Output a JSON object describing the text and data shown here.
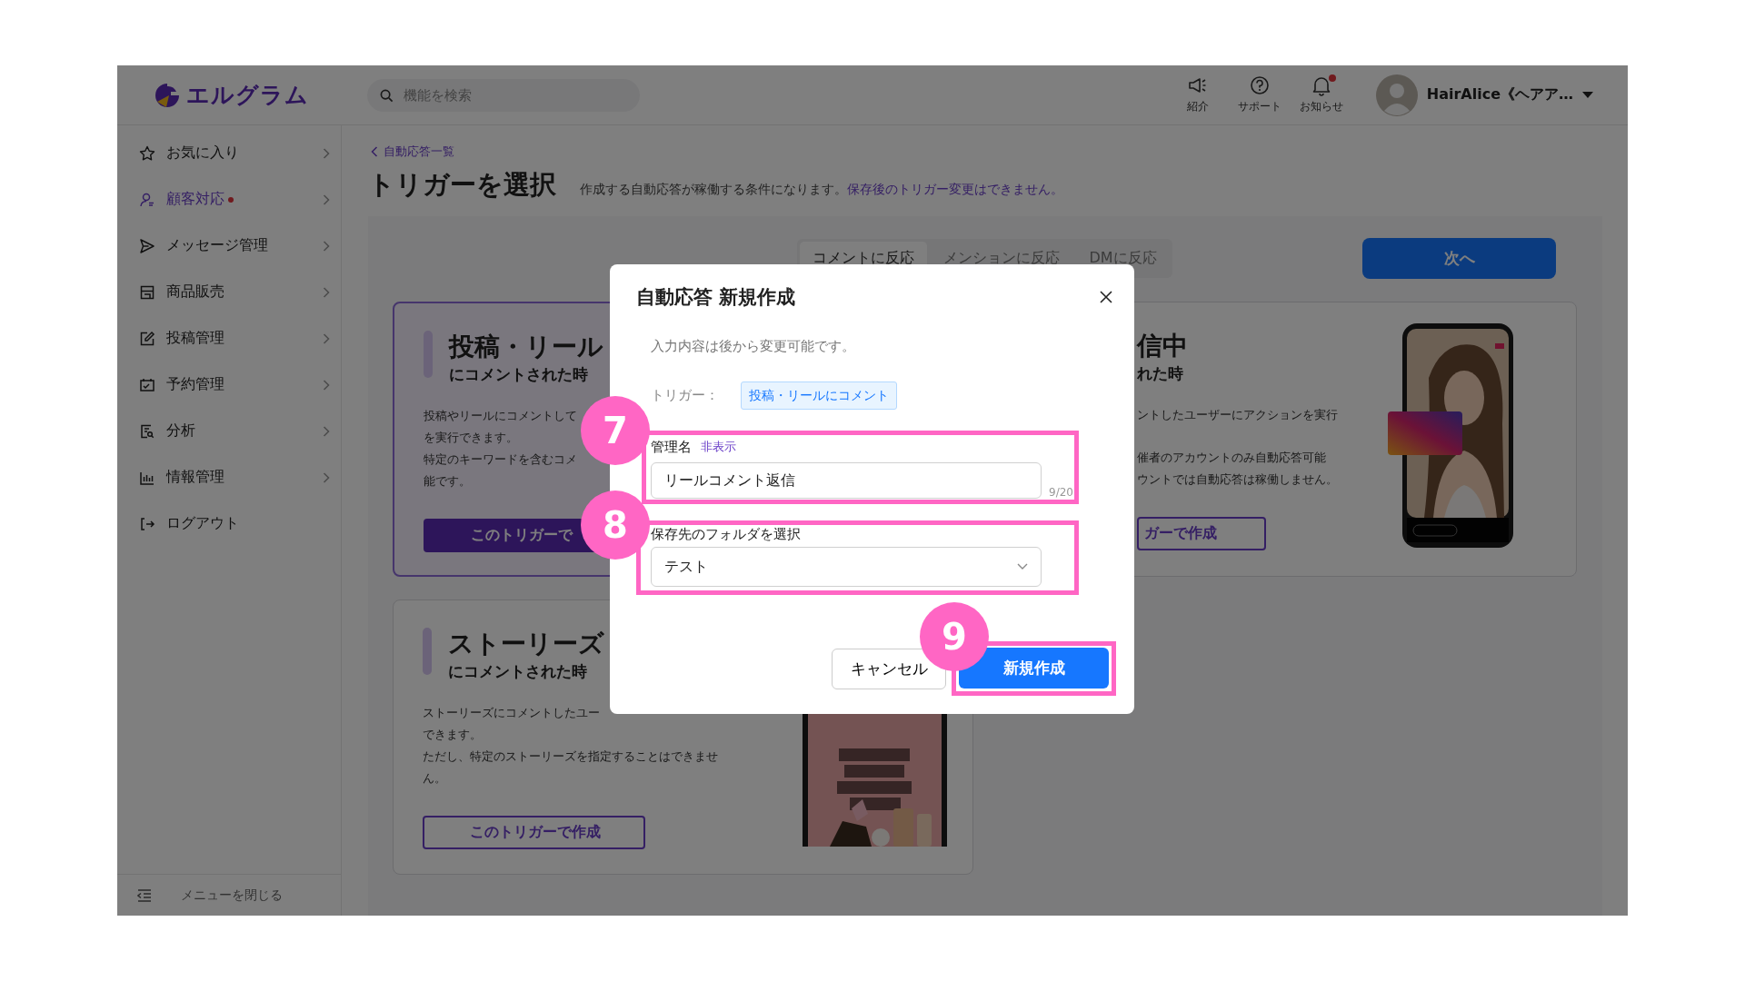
{
  "topbar": {
    "logo": "エルグラム",
    "search": {
      "placeholder": "機能を検索"
    },
    "actions": [
      {
        "label": "紹介",
        "kind": "megaphone",
        "badge": false
      },
      {
        "label": "サポート",
        "kind": "help",
        "badge": false
      },
      {
        "label": "お知らせ",
        "kind": "bell",
        "badge": true
      }
    ],
    "user": {
      "name": "HairAlice《ヘアア…"
    }
  },
  "sidebar": {
    "items": [
      {
        "label": "お気に入り",
        "kind": "star",
        "selected": false,
        "badge": false,
        "chevron": true
      },
      {
        "label": "顧客対応",
        "kind": "user",
        "selected": true,
        "badge": true,
        "chevron": true
      },
      {
        "label": "メッセージ管理",
        "kind": "send",
        "selected": false,
        "badge": false,
        "chevron": true
      },
      {
        "label": "商品販売",
        "kind": "store",
        "selected": false,
        "badge": false,
        "chevron": true
      },
      {
        "label": "投稿管理",
        "kind": "edit",
        "selected": false,
        "badge": false,
        "chevron": true
      },
      {
        "label": "予約管理",
        "kind": "calendar",
        "selected": false,
        "badge": false,
        "chevron": true
      },
      {
        "label": "分析",
        "kind": "report",
        "selected": false,
        "badge": false,
        "chevron": true
      },
      {
        "label": "情報管理",
        "kind": "chart",
        "selected": false,
        "badge": false,
        "chevron": true
      },
      {
        "label": "ログアウト",
        "kind": "logout",
        "selected": false,
        "badge": false,
        "chevron": false
      }
    ],
    "collapse": "メニューを閉じる"
  },
  "header": {
    "breadcrumb": "自動応答一覧",
    "title": "トリガーを選択",
    "description": "作成する自動応答が稼働する条件になります。",
    "notice": "保存後のトリガー変更はできません。"
  },
  "tabs": [
    {
      "label": "コメントに反応",
      "selected": true
    },
    {
      "label": "メンションに反応",
      "selected": false
    },
    {
      "label": "DMに反応",
      "selected": false
    }
  ],
  "next_button": "次へ",
  "cards": [
    {
      "kind": "post",
      "selected": true,
      "title": "投稿・リール",
      "subtitle": "にコメントされた時",
      "paragraphs": [
        [
          "投稿やリールにコメントして",
          "を実行できます。"
        ],
        [
          "特定のキーワードを含むコメ",
          "能です。"
        ]
      ],
      "button": "このトリガーで"
    },
    {
      "kind": "live",
      "selected": false,
      "title": "信中",
      "subtitle": "れた時",
      "paragraphs": [
        [
          "ントしたユーザーにアクションを実行"
        ],
        [
          "催者のアカウントのみ自動応答可能",
          "ウントでは自動応答は稼働しません。"
        ]
      ],
      "button": "ガーで作成"
    },
    {
      "kind": "story",
      "selected": false,
      "title": "ストーリーズ",
      "subtitle": "にコメントされた時",
      "paragraphs": [
        [
          "ストーリーズにコメントしたユー",
          "できます。"
        ],
        [
          "ただし、特定のストーリーズを指定することはできませ",
          "ん。"
        ]
      ],
      "button": "このトリガーで作成"
    }
  ],
  "dialog": {
    "title": "自動応答 新規作成",
    "note": "入力内容は後から変更可能です。",
    "trigger_label": "トリガー：",
    "trigger_tag": "投稿・リールにコメント",
    "name_field": {
      "label": "管理名",
      "toggle": "非表示",
      "value": "リールコメント返信",
      "counter": "9/20"
    },
    "folder_field": {
      "label": "保存先のフォルダを選択",
      "value": "テスト"
    },
    "cancel": "キャンセル",
    "submit": "新規作成"
  },
  "annotations": [
    {
      "label": "7"
    },
    {
      "label": "8"
    },
    {
      "label": "9"
    }
  ]
}
